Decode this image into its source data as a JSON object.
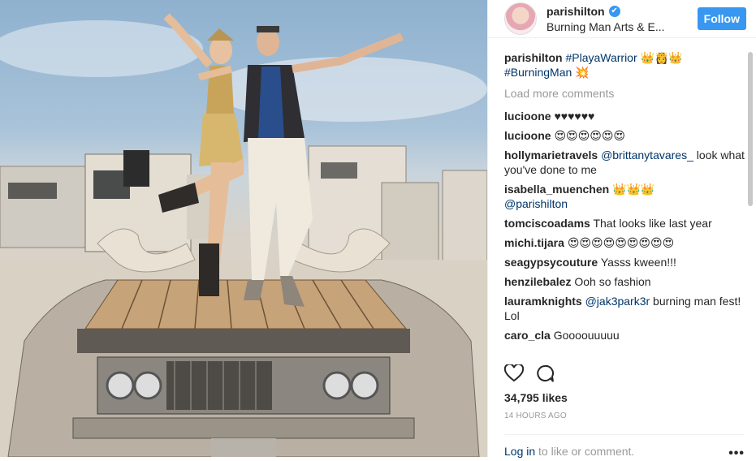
{
  "header": {
    "username": "parishilton",
    "verified_glyph": "✔",
    "location": "Burning Man Arts & E...",
    "follow_label": "Follow"
  },
  "caption": {
    "username": "parishilton",
    "text_line1": "#PlayaWarrior 👑👸👑",
    "text_line2": "#BurningMan 💥"
  },
  "load_more": "Load more comments",
  "comments": [
    {
      "user": "lucioone",
      "text": "♥♥♥♥♥♥"
    },
    {
      "user": "lucioone",
      "text": "😍😍😍😍😍😍"
    },
    {
      "user": "hollymarietravels",
      "mention": "@brittanytavares_",
      "text": " look what you've done to me"
    },
    {
      "user": "isabella_muenchen",
      "text": "👑👑👑 ",
      "mention2": "@parishilton"
    },
    {
      "user": "tomciscoadams",
      "text": "That looks like last year"
    },
    {
      "user": "michi.tijara",
      "text": "😍😍😍😍😍😍😍😍😍"
    },
    {
      "user": "seagypsycouture",
      "text": "Yasss kween!!!"
    },
    {
      "user": "henzilebalez",
      "text": "Ooh so fashion"
    },
    {
      "user": "lauramknights",
      "mention": "@jak3park3r",
      "text": " burning man fest! Lol"
    },
    {
      "user": "caro_cla",
      "text": "Goooouuuuu"
    }
  ],
  "likes": "34,795 likes",
  "time": "14 HOURS AGO",
  "footer": {
    "login": "Log in",
    "rest": " to like or comment.",
    "more": "•••"
  },
  "icons": {
    "like": "heart-icon",
    "comment": "comment-icon",
    "verified": "verified-badge-icon"
  },
  "colors": {
    "accent": "#3897f0",
    "link": "#003569",
    "muted": "#999999"
  }
}
